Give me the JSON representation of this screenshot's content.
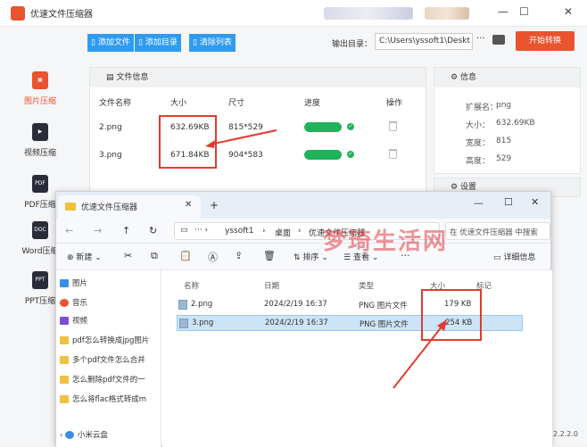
{
  "app": {
    "title": "优速文件压缩器",
    "toolbar": {
      "add_file": "添加文件",
      "add_dir": "添加目录",
      "clear_list": "清除列表"
    },
    "output_label": "输出目录：",
    "output_path": "C:\\Users\\yssoft1\\Deskt",
    "output_more": "···",
    "start_button": "开始转换",
    "sidebar": [
      {
        "label": "图片压缩",
        "icon": "image-icon",
        "active": true
      },
      {
        "label": "视频压缩",
        "icon": "video-icon",
        "active": false
      },
      {
        "label": "PDF压缩",
        "icon": "pdf-icon",
        "icon_text": "PDF",
        "active": false
      },
      {
        "label": "Word压缩",
        "icon": "doc-icon",
        "icon_text": "DOC",
        "active": false
      },
      {
        "label": "PPT压缩",
        "icon": "ppt-icon",
        "icon_text": "PPT",
        "active": false
      }
    ],
    "file_panel": {
      "header": "文件信息",
      "columns": [
        "文件名称",
        "大小",
        "尺寸",
        "进度",
        "操作"
      ],
      "rows": [
        {
          "name": "2.png",
          "size": "632.69KB",
          "dims": "815*529"
        },
        {
          "name": "3.png",
          "size": "671.84KB",
          "dims": "904*583"
        }
      ]
    },
    "info_panel": {
      "header": "信息",
      "rows": [
        {
          "key": "扩展名：",
          "value": "png"
        },
        {
          "key": "大小：",
          "value": "632.69KB"
        },
        {
          "key": "宽度：",
          "value": "815"
        },
        {
          "key": "高度：",
          "value": "529"
        }
      ]
    },
    "settings_header": "设置",
    "version": "2.2.2.0"
  },
  "explorer": {
    "tab_title": "优速文件压缩器",
    "new_tab": "+",
    "window_controls": {
      "minimize": "—",
      "maximize": "☐",
      "close": "✕"
    },
    "breadcrumb": [
      "yssoft1",
      "桌面",
      "优速文件压缩器"
    ],
    "search_placeholder": "在 优速文件压缩器 中搜索",
    "cmd": {
      "new": "新建",
      "sort": "排序",
      "view": "查看",
      "more": "···",
      "details": "详细信息"
    },
    "nav": [
      {
        "label": "图片",
        "color": "#3a8ee6"
      },
      {
        "label": "音乐",
        "color": "#e9532d"
      },
      {
        "label": "视频",
        "color": "#7a4fd8"
      },
      {
        "label": "pdf怎么转换成jpg图片",
        "color": "#f0c040"
      },
      {
        "label": "多个pdf文件怎么合并",
        "color": "#f0c040"
      },
      {
        "label": "怎么删除pdf文件的一",
        "color": "#f0c040"
      },
      {
        "label": "怎么将flac格式转成m",
        "color": "#f0c040"
      }
    ],
    "nav_bottom": "小米云盘",
    "columns": [
      "名称",
      "日期",
      "类型",
      "大小",
      "标记"
    ],
    "files": [
      {
        "name": "2.png",
        "date": "2024/2/19 16:37",
        "type": "PNG 图片文件",
        "size": "179 KB",
        "selected": false
      },
      {
        "name": "3.png",
        "date": "2024/2/19 16:37",
        "type": "PNG 图片文件",
        "size": "254 KB",
        "selected": true
      }
    ]
  },
  "watermark": "梦琦生活网",
  "colors": {
    "accent_blue": "#2f9bf0",
    "accent_orange": "#e9532d",
    "progress_green": "#20b15a",
    "annotation_red": "#e23b2e"
  }
}
